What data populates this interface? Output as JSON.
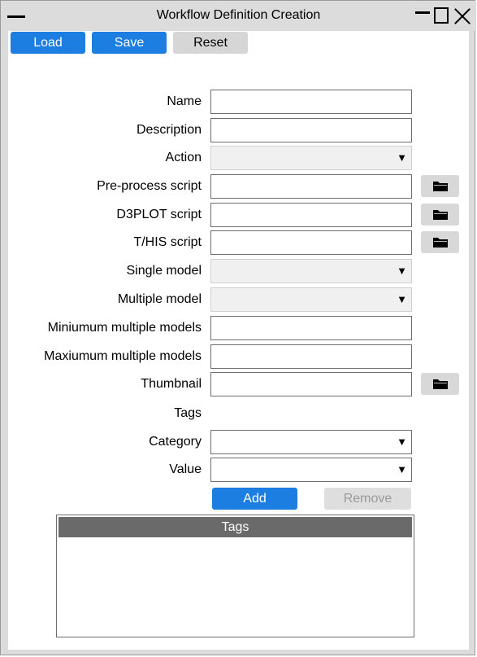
{
  "window": {
    "title": "Workflow Definition Creation"
  },
  "toolbar": {
    "load_label": "Load",
    "save_label": "Save",
    "reset_label": "Reset"
  },
  "form": {
    "name_label": "Name",
    "name_value": "",
    "description_label": "Description",
    "description_value": "",
    "action_label": "Action",
    "action_value": "",
    "preprocess_label": "Pre-process script",
    "preprocess_value": "",
    "d3plot_label": "D3PLOT script",
    "d3plot_value": "",
    "this_label": "T/HIS script",
    "this_value": "",
    "single_model_label": "Single model",
    "single_model_value": "",
    "multiple_model_label": "Multiple model",
    "multiple_model_value": "",
    "min_multiple_label": "Miniumum multiple models",
    "min_multiple_value": "",
    "max_multiple_label": "Maxiumum multiple models",
    "max_multiple_value": "",
    "thumbnail_label": "Thumbnail",
    "thumbnail_value": "",
    "tags_heading": "Tags",
    "category_label": "Category",
    "category_value": "",
    "value_label": "Value",
    "value_value": ""
  },
  "tag_actions": {
    "add_label": "Add",
    "remove_label": "Remove"
  },
  "tags_table": {
    "header": "Tags",
    "rows": []
  },
  "icons": {
    "dropdown": "▼",
    "folder": "folder-icon"
  },
  "colors": {
    "accent": "#1c7ee0",
    "window_bg": "#dcdcdc",
    "table_header": "#6a6a6a"
  }
}
